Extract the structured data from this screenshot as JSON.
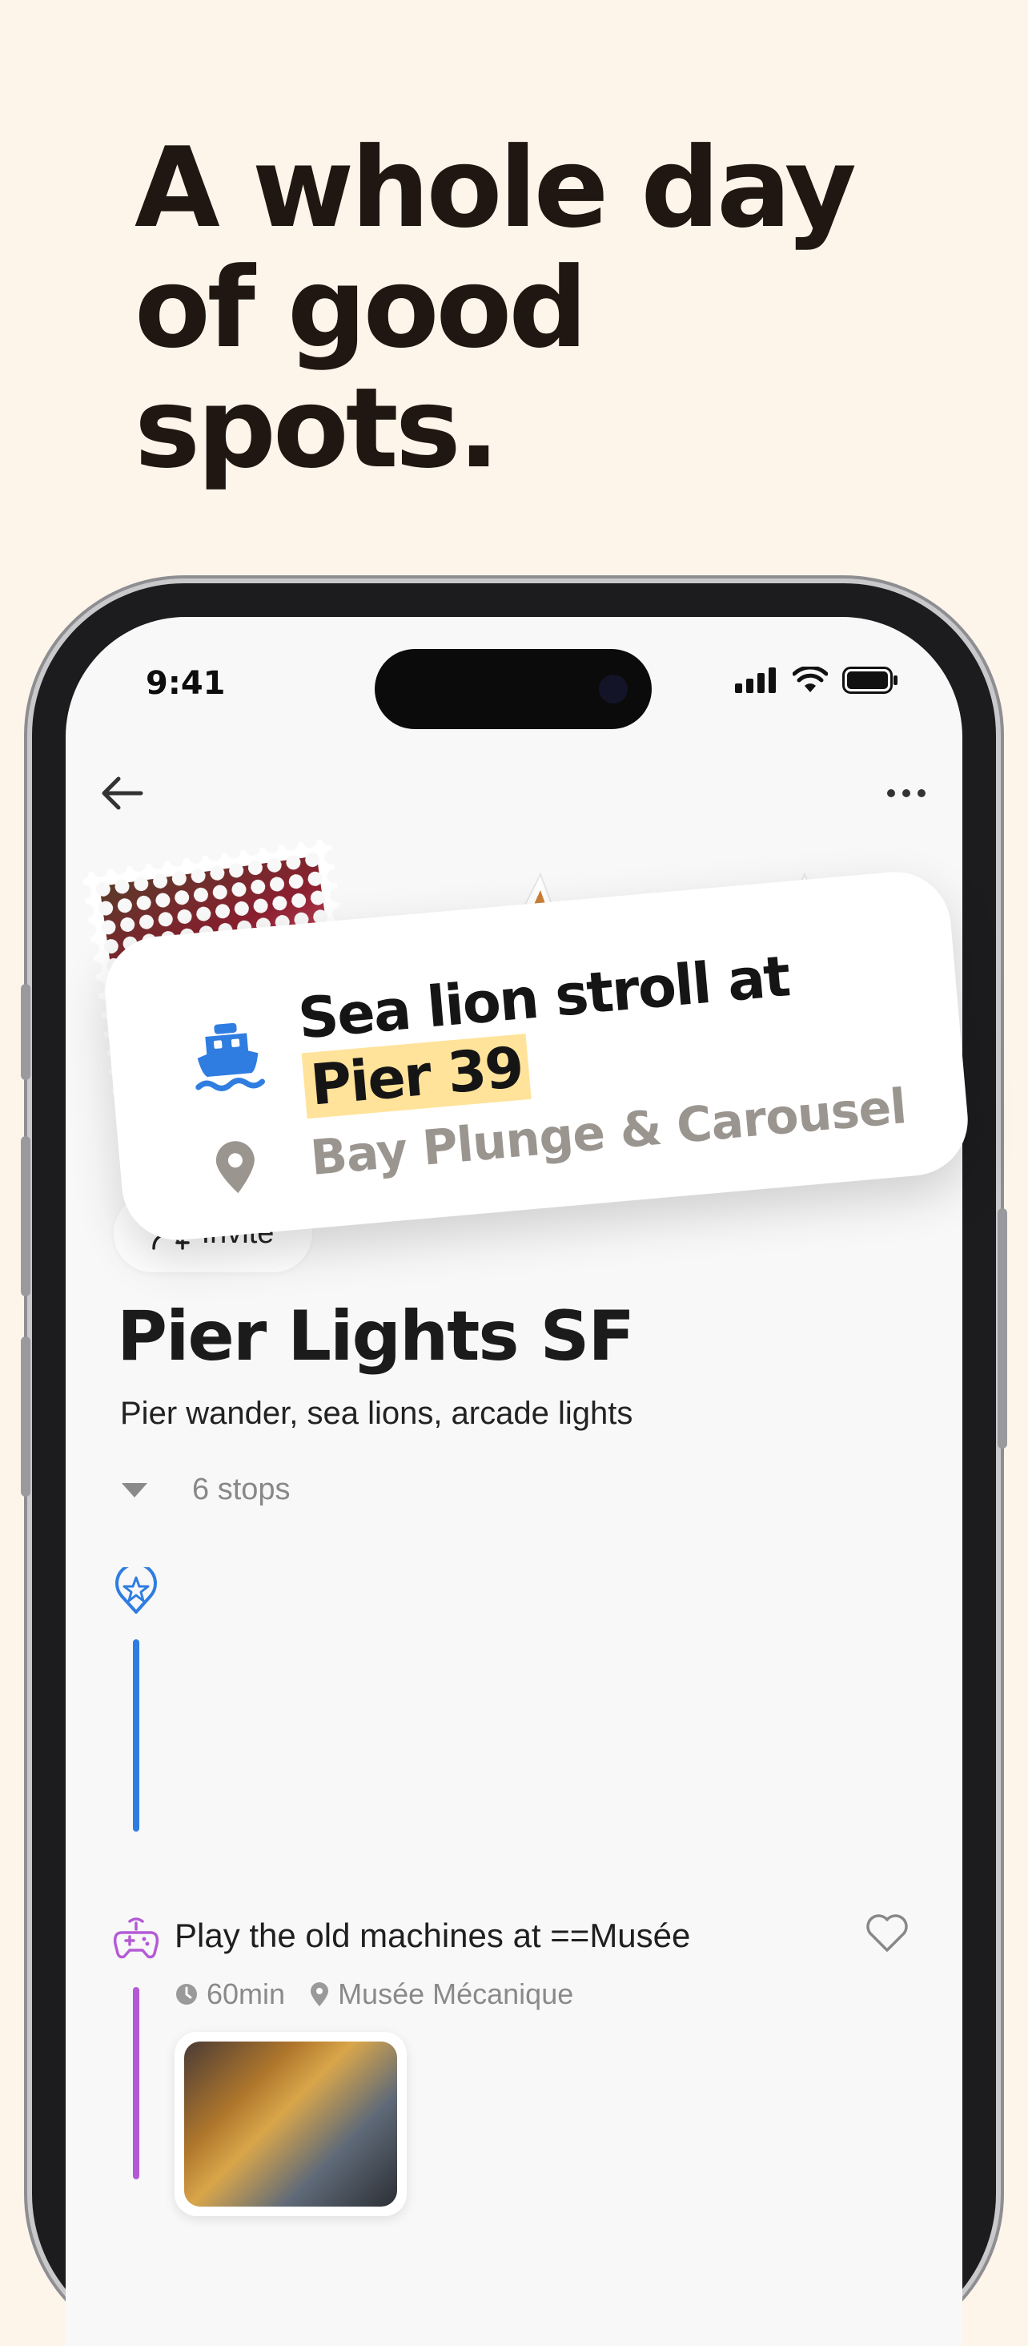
{
  "marketing": {
    "headline": "A whole day of good spots."
  },
  "status_bar": {
    "time": "9:41"
  },
  "trip": {
    "invite_label": "Invite",
    "title": "Pier Lights SF",
    "subtitle": "Pier wander, sea lions, arcade lights",
    "stops_count": "6 stops"
  },
  "featured_card": {
    "title_prefix": "Sea lion stroll at ",
    "title_highlight": "Pier 39",
    "location": "Bay Plunge & Carousel",
    "icon": "ferry-icon"
  },
  "activities": [
    {
      "title": "Play the old machines at ==Musée",
      "duration": "60min",
      "location": "Musée Mécanique",
      "icon": "gamepad-icon",
      "accent": "#b35bd6"
    }
  ],
  "colors": {
    "background": "#fdf5ea",
    "accent_blue": "#2f7de1",
    "highlight": "#ffe39a"
  }
}
